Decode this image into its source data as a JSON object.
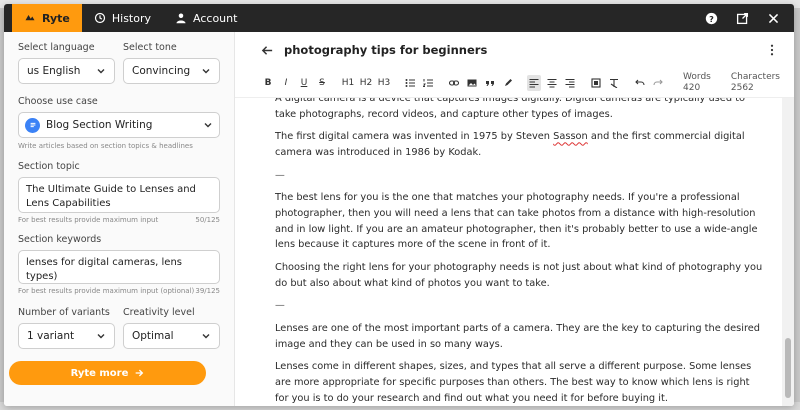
{
  "tabs": [
    {
      "label": "Ryte",
      "icon": "ryte-logo-icon",
      "active": true
    },
    {
      "label": "History",
      "icon": "history-icon",
      "active": false
    },
    {
      "label": "Account",
      "icon": "user-icon",
      "active": false
    }
  ],
  "header_icons": [
    "help-icon",
    "open-external-icon",
    "close-icon"
  ],
  "left": {
    "language_label": "Select language",
    "language_value": "us English",
    "tone_label": "Select tone",
    "tone_value": "Convincing",
    "usecase_label": "Choose use case",
    "usecase_value": "Blog Section Writing",
    "usecase_hint": "Write articles based on section topics & headlines",
    "topic_label": "Section topic",
    "topic_value": "The Ultimate Guide to Lenses and Lens Capabilities",
    "topic_hint": "For best results provide maximum input",
    "topic_count": "50/125",
    "keywords_label": "Section keywords",
    "keywords_value": "lenses for digital cameras, lens types)",
    "keywords_hint": "For best results provide maximum input (optional)",
    "keywords_count": "39/125",
    "variants_label": "Number of variants",
    "variants_value": "1 variant",
    "creativity_label": "Creativity level",
    "creativity_value": "Optimal",
    "button_label": "Ryte more"
  },
  "editor": {
    "title": "photography tips for beginners",
    "toolbar": {
      "bold": "B",
      "italic": "I",
      "underline": "U",
      "strike": "S",
      "h1": "H1",
      "h2": "H2",
      "h3": "H3"
    },
    "words_label": "Words",
    "words_value": "420",
    "chars_label": "Characters",
    "chars_value": "2562",
    "paragraphs": {
      "p0": "A digital camera is a device that captures images digitally. Digital cameras are typically used to take photographs, record videos, and capture other types of images.",
      "p1a": "The first digital camera was invented in 1975 by Steven ",
      "p1b": "Sasson",
      "p1c": " and the first commercial digital camera was introduced in 1986 by Kodak.",
      "sep1": "—",
      "p2": "The best lens for you is the one that matches your photography needs. If you're a professional photographer, then you will need a lens that can take photos from a distance with high-resolution and in low light. If you are an amateur photographer, then it's probably better to use a wide-angle lens because it captures more of the scene in front of it.",
      "p3": "Choosing the right lens for your photography needs is not just about what kind of photography you do but also about what kind of photos you want to take.",
      "sep2": "—",
      "p4": "Lenses are one of the most important parts of a camera. They are the key to capturing the desired image and they can be used in so many ways.",
      "p5": "Lenses come in different shapes, sizes, and types that all serve a different purpose. Some lenses are more appropriate for specific purposes than others. The best way to know which lens is right for you is to do your research and find out what you need it for before buying it."
    }
  },
  "colors": {
    "accent": "#ff9a0e",
    "header_bg": "#262626",
    "usecase_icon": "#3b82f6"
  }
}
